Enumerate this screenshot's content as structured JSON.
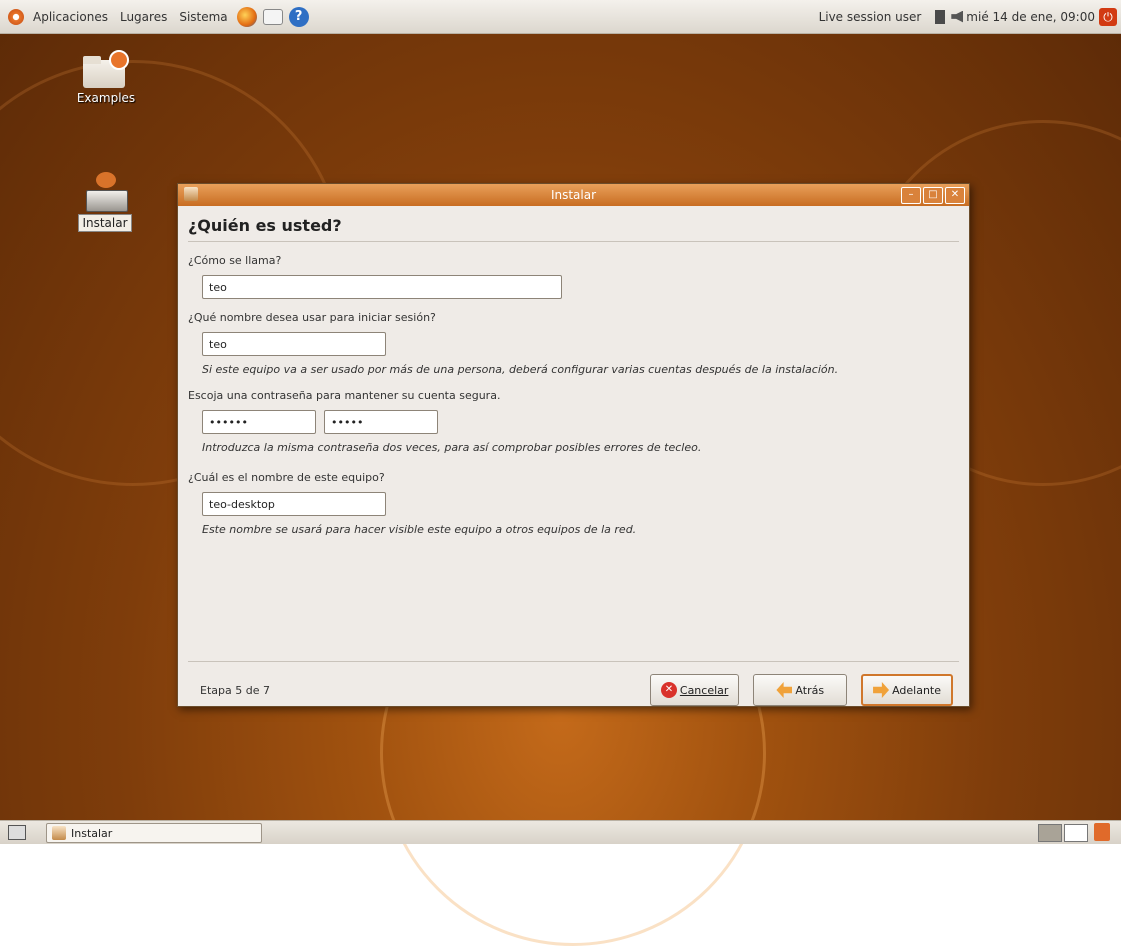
{
  "top_panel": {
    "menu_applications": "Aplicaciones",
    "menu_places": "Lugares",
    "menu_system": "Sistema",
    "user": "Live session user",
    "clock": "mié 14 de ene, 09:00"
  },
  "desktop_icons": [
    {
      "label": "Examples"
    },
    {
      "label": "Instalar"
    }
  ],
  "window": {
    "title": "Instalar",
    "heading": "¿Quién es usted?",
    "name_label": "¿Cómo se llama?",
    "name_value": "teo",
    "login_label": "¿Qué nombre desea usar para iniciar sesión?",
    "login_value": "teo",
    "login_hint": "Si este equipo va a ser usado por más de una persona, deberá configurar varias cuentas después de la instalación.",
    "password_label": "Escoja una contraseña para mantener su cuenta segura.",
    "password_value": "••••••",
    "password_confirm_value": "•••••",
    "password_hint": "Introduzca la misma contraseña dos veces, para así comprobar posibles errores de tecleo.",
    "computer_label": "¿Cuál es el nombre de este equipo?",
    "computer_value": "teo-desktop",
    "computer_hint": "Este nombre se usará para hacer visible este equipo a otros equipos de la red.",
    "step": "Etapa 5 de 7",
    "cancel_label": "Cancelar",
    "back_label": "Atrás",
    "forward_label": "Adelante"
  },
  "bottom_panel": {
    "task_label": "Instalar"
  },
  "colors": {
    "accent": "#d0772c",
    "title_bar": "#c86d22",
    "desktop": "#7f3d0b"
  }
}
